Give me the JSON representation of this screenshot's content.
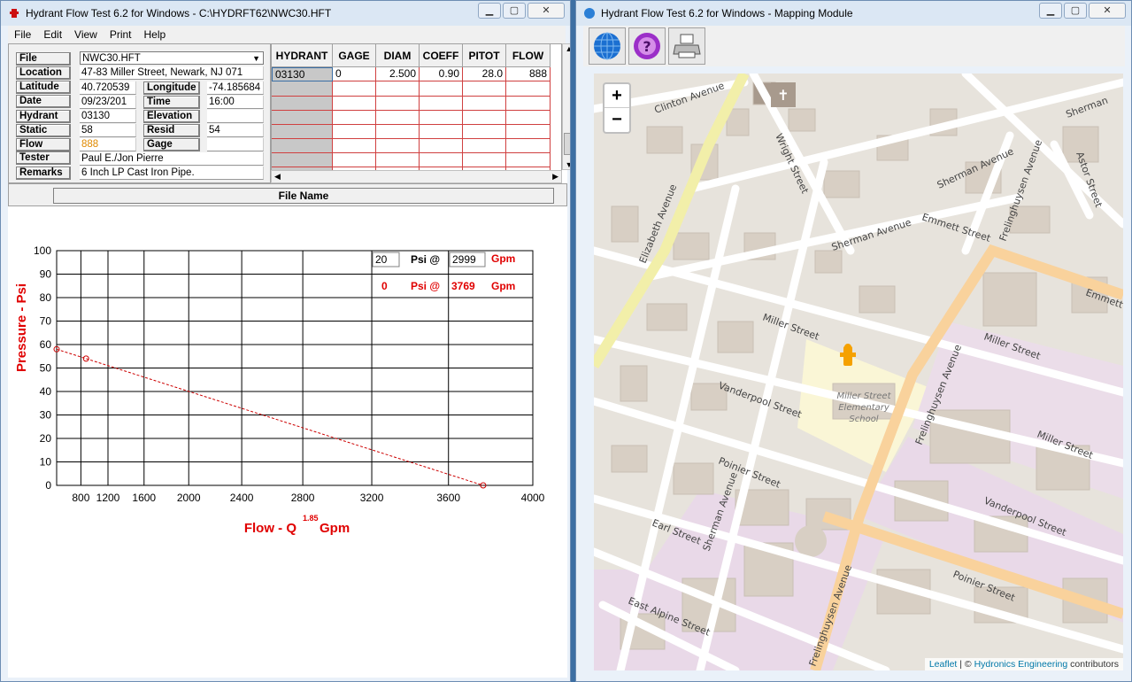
{
  "left_window": {
    "title": "Hydrant Flow Test 6.2 for Windows - C:\\HYDRFT62\\NWC30.HFT",
    "menu": [
      "File",
      "Edit",
      "View",
      "Print",
      "Help"
    ],
    "form": {
      "file_label": "File",
      "file_value": "NWC30.HFT",
      "location_label": "Location",
      "location_value": "47-83 Miller Street, Newark, NJ 071",
      "latitude_label": "Latitude",
      "latitude_value": "40.720539",
      "longitude_label": "Longitude",
      "longitude_value": "-74.185684",
      "date_label": "Date",
      "date_value": "09/23/201",
      "time_label": "Time",
      "time_value": "16:00",
      "hydrant_label": "Hydrant",
      "hydrant_value": "03130",
      "elevation_label": "Elevation",
      "elevation_value": "",
      "static_label": "Static",
      "static_value": "58",
      "resid_label": "Resid",
      "resid_value": "54",
      "flow_label": "Flow",
      "flow_value": "888",
      "gage_label": "Gage",
      "gage_value": "",
      "tester_label": "Tester",
      "tester_value": "Paul E./Jon Pierre",
      "remarks_label": "Remarks",
      "remarks_value": "6 Inch LP Cast Iron Pipe."
    },
    "grid": {
      "headers": [
        "HYDRANT",
        "GAGE",
        "DIAM",
        "COEFF",
        "PITOT",
        "FLOW"
      ],
      "row": [
        "03130",
        "0",
        "2.500",
        "0.90",
        "28.0",
        "888"
      ]
    },
    "file_name_header": "File Name",
    "psi_row1": {
      "psi": "20",
      "psi_at": "Psi @",
      "gpm": "2999",
      "unit": "Gpm"
    },
    "psi_row2": {
      "psi": "0",
      "psi_at": "Psi @",
      "gpm": "3769",
      "unit": "Gpm"
    }
  },
  "chart_data": {
    "type": "line",
    "ylabel": "Pressure - Psi",
    "xlabel": "Flow - Q",
    "xlabel_exponent": "1.85",
    "xlabel_unit": "Gpm",
    "x_ticks": [
      "800",
      "1200",
      "1600",
      "2000",
      "2400",
      "2800",
      "3200",
      "3600",
      "4000"
    ],
    "y_ticks": [
      "100",
      "90",
      "80",
      "70",
      "60",
      "50",
      "40",
      "30",
      "20",
      "10",
      "0"
    ],
    "ylim": [
      0,
      100
    ],
    "xlim": [
      0,
      4000
    ],
    "x_scale": "Q^1.85",
    "points": [
      {
        "x": 0,
        "y": 58
      },
      {
        "x": 888,
        "y": 54
      },
      {
        "x": 3769,
        "y": 0
      }
    ],
    "line_style": "dashed",
    "color": "#cc0000"
  },
  "right_window": {
    "title": "Hydrant Flow Test 6.2 for Windows - Mapping Module",
    "tools": [
      "globe-icon",
      "help-icon",
      "printer-icon"
    ],
    "zoom_in": "+",
    "zoom_out": "−",
    "streets": [
      "Clinton Avenue",
      "Wright Street",
      "Elizabeth Avenue",
      "Sherman Avenue",
      "Emmett Street",
      "Frelinghuysen Avenue",
      "Astor Street",
      "Miller Street",
      "Vanderpool Street",
      "Poinier Street",
      "Earl Street",
      "East Alpine Street",
      "Emmett",
      "Sherman"
    ],
    "poi": [
      "Miller Street",
      "Elementary",
      "School"
    ],
    "attribution_leaflet": "Leaflet",
    "attribution_sep": " | © ",
    "attribution_owner": "Hydronics Engineering",
    "attribution_tail": " contributors"
  }
}
